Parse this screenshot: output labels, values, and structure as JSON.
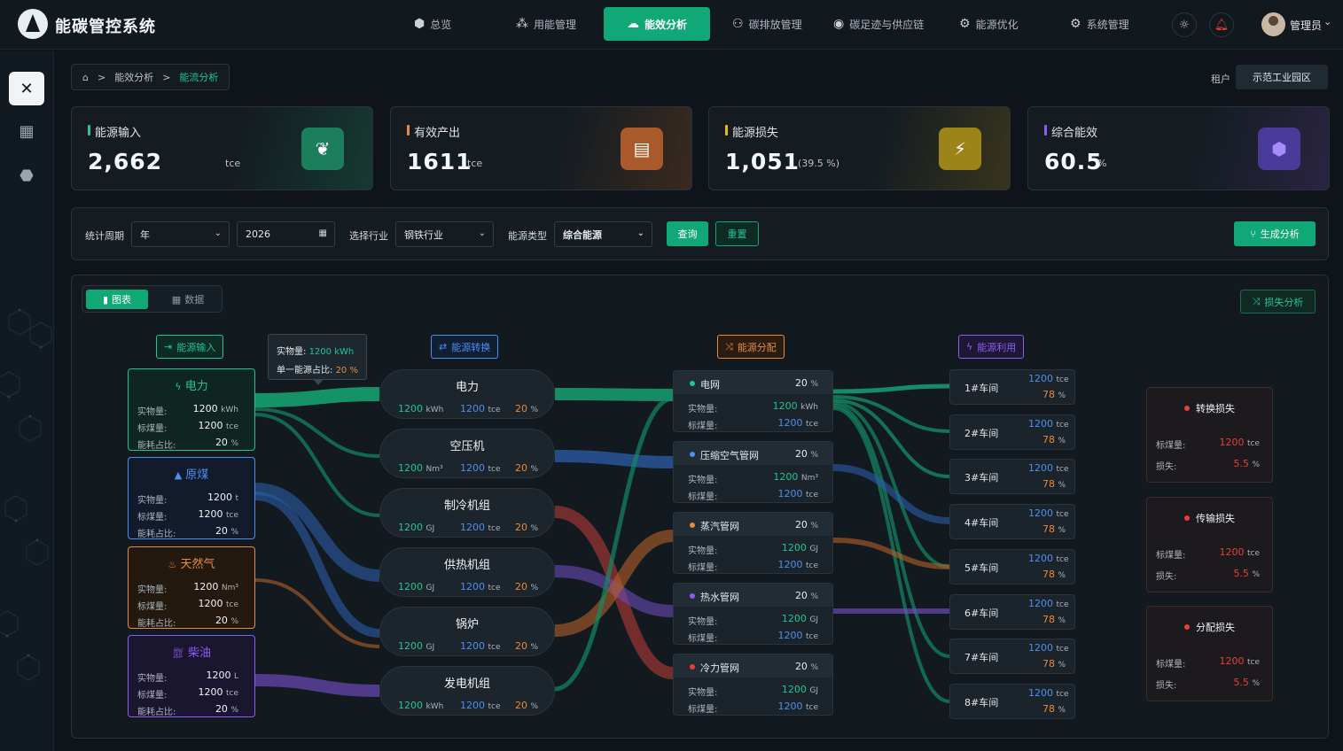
{
  "app": {
    "title": "能碳管控系统"
  },
  "nav": [
    {
      "label": "总览",
      "icon": "cube-icon"
    },
    {
      "label": "用能管理",
      "icon": "nodes-icon"
    },
    {
      "label": "能效分析",
      "icon": "cloud-icon",
      "active": true
    },
    {
      "label": "碳排放管理",
      "icon": "network-icon"
    },
    {
      "label": "碳足迹与供应链",
      "icon": "target-icon"
    },
    {
      "label": "能源优化",
      "icon": "gear-icon"
    },
    {
      "label": "系统管理",
      "icon": "settings-icon"
    }
  ],
  "user": {
    "name": "管理员"
  },
  "breadcrumb": {
    "home": "⌂",
    "sep": ">",
    "level1": "能效分析",
    "level2": "能流分析"
  },
  "tenant": {
    "label": "租户",
    "value": "示范工业园区"
  },
  "kpis": [
    {
      "label": "能源输入",
      "value": "2,662",
      "unit": "tce",
      "color": "#1fc592",
      "icon": "plant-icon"
    },
    {
      "label": "有效产出",
      "value": "1611",
      "unit": "tce",
      "color": "#e88a3b",
      "icon": "document-icon"
    },
    {
      "label": "能源损失",
      "value": "1,051",
      "unit": "(39.5 %)",
      "color": "#e3b923",
      "icon": "flash-box-icon"
    },
    {
      "label": "综合能效",
      "value": "60.5",
      "unit": "%",
      "color": "#8b5cf6",
      "icon": "hexagon-icon"
    }
  ],
  "filters": {
    "period_label": "统计周期",
    "period_value": "年",
    "year_value": "2026",
    "industry_label": "选择行业",
    "industry_value": "钢铁行业",
    "energy_label": "能源类型",
    "energy_value": "综合能源",
    "query": "查询",
    "reset": "重置",
    "generate": "生成分析"
  },
  "view_toggle": {
    "chart": "图表",
    "data": "数据"
  },
  "loss_analysis_btn": "损失分析",
  "stages": {
    "input": "能源输入",
    "convert": "能源转换",
    "distribute": "能源分配",
    "use": "能源利用"
  },
  "tooltip": {
    "amount_label": "实物量:",
    "amount_value": "1200 kWh",
    "share_label": "单一能源占比:",
    "share_value": "20 %"
  },
  "sources": [
    {
      "name": "电力",
      "amount": "1200",
      "amount_unit": "kWh",
      "std": "1200",
      "std_unit": "tce",
      "ratio": "20",
      "ratio_unit": "%",
      "color": "#1fc592"
    },
    {
      "name": "原煤",
      "amount": "1200",
      "amount_unit": "t",
      "std": "1200",
      "std_unit": "tce",
      "ratio": "20",
      "ratio_unit": "%",
      "color": "#4d8ef0"
    },
    {
      "name": "天然气",
      "amount": "1200",
      "amount_unit": "Nm³",
      "std": "1200",
      "std_unit": "tce",
      "ratio": "20",
      "ratio_unit": "%",
      "color": "#e88a3b"
    },
    {
      "name": "柴油",
      "amount": "1200",
      "amount_unit": "L",
      "std": "1200",
      "std_unit": "tce",
      "ratio": "20",
      "ratio_unit": "%",
      "color": "#8b5cf6"
    }
  ],
  "source_row_labels": {
    "amount": "实物量:",
    "std": "标煤量:",
    "ratio": "能耗占比:"
  },
  "conversions": [
    {
      "name": "电力",
      "amount": "1200",
      "amount_unit": "kWh",
      "std": "1200",
      "std_unit": "tce",
      "pct": "20",
      "pct_unit": "%"
    },
    {
      "name": "空压机",
      "amount": "1200",
      "amount_unit": "Nm³",
      "std": "1200",
      "std_unit": "tce",
      "pct": "20",
      "pct_unit": "%"
    },
    {
      "name": "制冷机组",
      "amount": "1200",
      "amount_unit": "GJ",
      "std": "1200",
      "std_unit": "tce",
      "pct": "20",
      "pct_unit": "%"
    },
    {
      "name": "供热机组",
      "amount": "1200",
      "amount_unit": "GJ",
      "std": "1200",
      "std_unit": "tce",
      "pct": "20",
      "pct_unit": "%"
    },
    {
      "name": "锅炉",
      "amount": "1200",
      "amount_unit": "GJ",
      "std": "1200",
      "std_unit": "tce",
      "pct": "20",
      "pct_unit": "%"
    },
    {
      "name": "发电机组",
      "amount": "1200",
      "amount_unit": "kWh",
      "std": "1200",
      "std_unit": "tce",
      "pct": "20",
      "pct_unit": "%"
    }
  ],
  "distributions": [
    {
      "name": "电网",
      "pct": "20",
      "pct_unit": "%",
      "amount": "1200",
      "amount_unit": "kWh",
      "std": "1200",
      "std_unit": "tce",
      "color": "#1fc592"
    },
    {
      "name": "压缩空气管网",
      "pct": "20",
      "pct_unit": "%",
      "amount": "1200",
      "amount_unit": "Nm³",
      "std": "1200",
      "std_unit": "tce",
      "color": "#4d8ef0"
    },
    {
      "name": "蒸汽管网",
      "pct": "20",
      "pct_unit": "%",
      "amount": "1200",
      "amount_unit": "GJ",
      "std": "1200",
      "std_unit": "tce",
      "color": "#e88a3b"
    },
    {
      "name": "热水管网",
      "pct": "20",
      "pct_unit": "%",
      "amount": "1200",
      "amount_unit": "GJ",
      "std": "1200",
      "std_unit": "tce",
      "color": "#8b5cf6"
    },
    {
      "name": "冷力管网",
      "pct": "20",
      "pct_unit": "%",
      "amount": "1200",
      "amount_unit": "GJ",
      "std": "1200",
      "std_unit": "tce",
      "color": "#e5403c"
    }
  ],
  "dist_row_labels": {
    "amount": "实物量:",
    "std": "标煤量:"
  },
  "workshops": [
    {
      "name": "1#车间",
      "value": "1200",
      "value_unit": "tce",
      "pct": "78",
      "pct_unit": "%"
    },
    {
      "name": "2#车间",
      "value": "1200",
      "value_unit": "tce",
      "pct": "78",
      "pct_unit": "%"
    },
    {
      "name": "3#车间",
      "value": "1200",
      "value_unit": "tce",
      "pct": "78",
      "pct_unit": "%"
    },
    {
      "name": "4#车间",
      "value": "1200",
      "value_unit": "tce",
      "pct": "78",
      "pct_unit": "%"
    },
    {
      "name": "5#车间",
      "value": "1200",
      "value_unit": "tce",
      "pct": "78",
      "pct_unit": "%"
    },
    {
      "name": "6#车间",
      "value": "1200",
      "value_unit": "tce",
      "pct": "78",
      "pct_unit": "%"
    },
    {
      "name": "7#车间",
      "value": "1200",
      "value_unit": "tce",
      "pct": "78",
      "pct_unit": "%"
    },
    {
      "name": "8#车间",
      "value": "1200",
      "value_unit": "tce",
      "pct": "78",
      "pct_unit": "%"
    }
  ],
  "losses": [
    {
      "name": "转换损失",
      "std": "1200",
      "std_unit": "tce",
      "loss": "5.5",
      "loss_unit": "%"
    },
    {
      "name": "传输损失",
      "std": "1200",
      "std_unit": "tce",
      "loss": "5.5",
      "loss_unit": "%"
    },
    {
      "name": "分配损失",
      "std": "1200",
      "std_unit": "tce",
      "loss": "5.5",
      "loss_unit": "%"
    }
  ],
  "loss_row_labels": {
    "std": "标煤量:",
    "loss": "损失:"
  }
}
